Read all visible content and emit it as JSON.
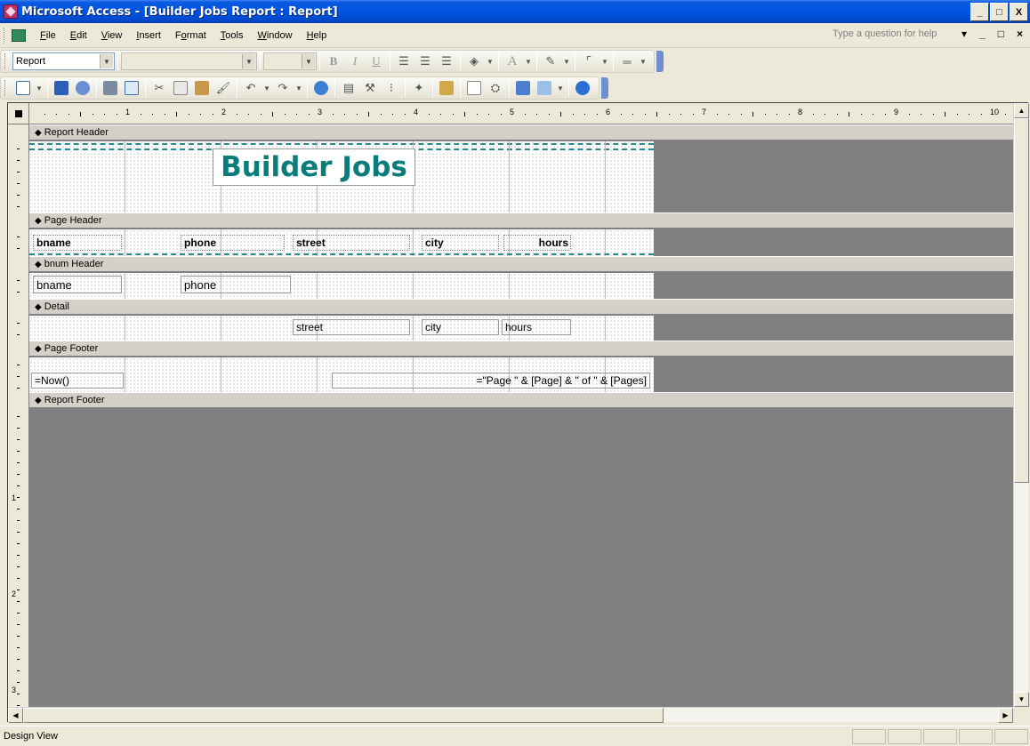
{
  "window": {
    "title": "Microsoft Access - [Builder Jobs Report : Report]",
    "controls": [
      "_",
      "□",
      "X"
    ]
  },
  "menubar": {
    "items": [
      "File",
      "Edit",
      "View",
      "Insert",
      "Format",
      "Tools",
      "Window",
      "Help"
    ],
    "help_placeholder": "Type a question for help",
    "doc_controls": [
      "▾",
      "_",
      "□",
      "×"
    ]
  },
  "formatting_toolbar": {
    "object_select": "Report",
    "font_select": "",
    "size_select": "",
    "bold": "B",
    "italic": "I",
    "underline": "U",
    "font_color": "A"
  },
  "design_toolbar": {
    "icons": [
      "view-icon",
      "save-icon",
      "search-icon",
      "print-icon",
      "print-preview-icon",
      "cut-icon",
      "copy-icon",
      "paste-icon",
      "format-painter-icon",
      "undo-icon",
      "redo-icon",
      "hyperlink-icon",
      "field-list-icon",
      "toolbox-icon",
      "sorting-grouping-icon",
      "autoformat-icon",
      "code-icon",
      "properties-icon",
      "build-icon",
      "database-window-icon",
      "new-object-icon",
      "help-icon"
    ]
  },
  "ruler": {
    "h_numbers": [
      "1",
      "2",
      "3",
      "4",
      "5",
      "6",
      "7",
      "8",
      "9",
      "10"
    ],
    "v_numbers": [
      "1",
      "2",
      "3"
    ]
  },
  "sections": {
    "report_header": {
      "label": "Report Header",
      "title": "Builder Jobs"
    },
    "page_header": {
      "label": "Page Header",
      "labels": [
        "bname",
        "phone",
        "street",
        "city",
        "hours"
      ]
    },
    "bnum_header": {
      "label": "bnum Header",
      "fields": [
        "bname",
        "phone"
      ]
    },
    "detail": {
      "label": "Detail",
      "fields": [
        "street",
        "city",
        "hours"
      ]
    },
    "page_footer": {
      "label": "Page Footer",
      "now": "=Now()",
      "page_expr": "=\"Page \" & [Page] & \" of \" & [Pages]"
    },
    "report_footer": {
      "label": "Report Footer"
    }
  },
  "statusbar": {
    "text": "Design View"
  }
}
